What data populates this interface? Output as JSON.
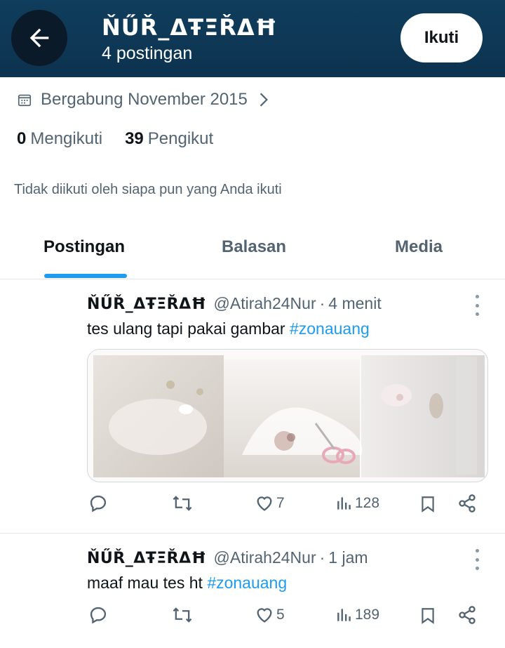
{
  "header": {
    "display_name": "ŇŰŘ_ΔŦΞŘΔĦ",
    "post_count": "4 postingan",
    "follow_label": "Ikuti"
  },
  "profile": {
    "joined": "Bergabung November 2015",
    "following_count": "0",
    "following_label": "Mengikuti",
    "followers_count": "39",
    "followers_label": "Pengikut",
    "not_followed_note": "Tidak diikuti oleh siapa pun yang Anda ikuti"
  },
  "tabs": [
    {
      "label": "Postingan",
      "active": true
    },
    {
      "label": "Balasan",
      "active": false
    },
    {
      "label": "Media",
      "active": false
    }
  ],
  "posts": [
    {
      "name": "ŇŰŘ_ΔŦΞŘΔĦ",
      "handle": "@Atirah24Nur",
      "time": "4 menit",
      "text": "tes ulang tapi pakai gambar ",
      "hashtag": "#zonauang",
      "has_media": true,
      "likes": "7",
      "views": "128"
    },
    {
      "name": "ŇŰŘ_ΔŦΞŘΔĦ",
      "handle": "@Atirah24Nur",
      "time": "1 jam",
      "text": "maaf mau tes ht ",
      "hashtag": "#zonauang",
      "has_media": false,
      "likes": "5",
      "views": "189"
    }
  ],
  "colors": {
    "header_bg": "#103d5c",
    "accent": "#1d9bf0",
    "muted_text": "#536471"
  },
  "icons": [
    "arrow-left-icon",
    "calendar-icon",
    "chevron-right-icon",
    "reply-icon",
    "repost-icon",
    "heart-icon",
    "views-icon",
    "bookmark-icon",
    "share-icon",
    "more-icon"
  ]
}
